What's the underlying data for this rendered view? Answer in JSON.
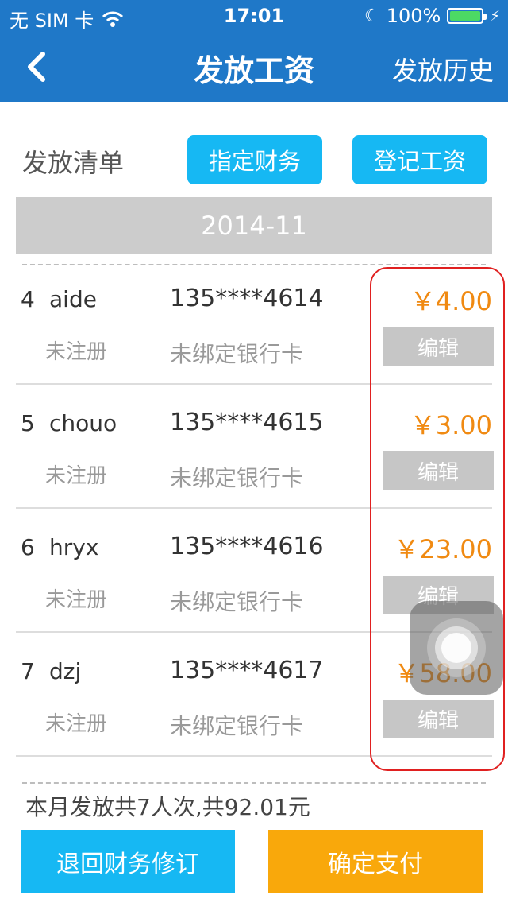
{
  "status_bar": {
    "carrier": "无 SIM 卡",
    "time": "17:01",
    "battery": "100%",
    "icons": [
      "wifi-icon",
      "moon-icon",
      "battery-icon",
      "charging-bolt-icon"
    ]
  },
  "nav": {
    "back_icon": "chevron-left-icon",
    "title": "发放工资",
    "right_label": "发放历史"
  },
  "header": {
    "section_label": "发放清单",
    "assign_button": "指定财务",
    "register_button": "登记工资"
  },
  "month": "2014-11",
  "rows": [
    {
      "index": "4",
      "name": "aide",
      "phone": "135****4614",
      "status": "未注册",
      "bank": "未绑定银行卡",
      "amount": "￥4.00",
      "edit": "编辑"
    },
    {
      "index": "5",
      "name": "chouo",
      "phone": "135****4615",
      "status": "未注册",
      "bank": "未绑定银行卡",
      "amount": "￥3.00",
      "edit": "编辑"
    },
    {
      "index": "6",
      "name": "hryx",
      "phone": "135****4616",
      "status": "未注册",
      "bank": "未绑定银行卡",
      "amount": "￥23.00",
      "edit": "编辑"
    },
    {
      "index": "7",
      "name": "dzj",
      "phone": "135****4617",
      "status": "未注册",
      "bank": "未绑定银行卡",
      "amount": "￥58.00",
      "edit": "编辑"
    }
  ],
  "summary": "本月发放共7人次,共92.01元",
  "footer": {
    "return_button": "退回财务修订",
    "pay_button": "确定支付"
  },
  "colors": {
    "nav_bg": "#1f78c8",
    "accent_blue": "#16b8f3",
    "accent_orange": "#f9a80b",
    "amount_orange": "#f08a12",
    "highlight_red": "#e02020"
  }
}
